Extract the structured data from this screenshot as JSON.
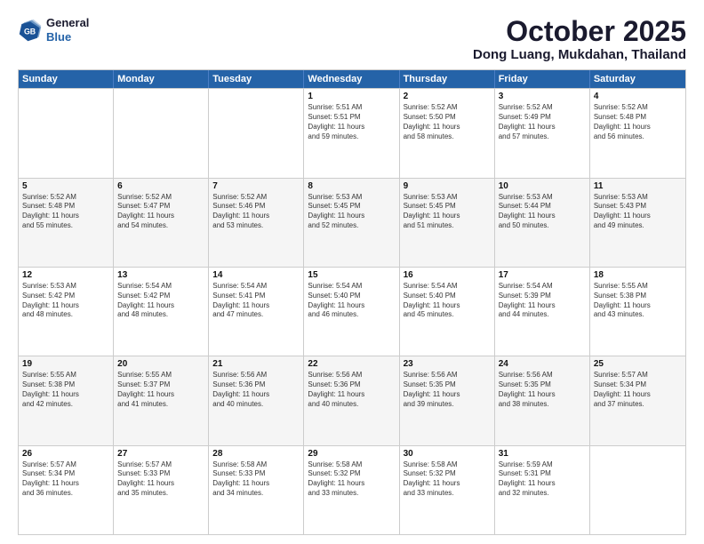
{
  "header": {
    "logo": {
      "general": "General",
      "blue": "Blue"
    },
    "title": "October 2025",
    "location": "Dong Luang, Mukdahan, Thailand"
  },
  "calendar": {
    "weekdays": [
      "Sunday",
      "Monday",
      "Tuesday",
      "Wednesday",
      "Thursday",
      "Friday",
      "Saturday"
    ],
    "rows": [
      [
        {
          "day": "",
          "empty": true
        },
        {
          "day": "",
          "empty": true
        },
        {
          "day": "",
          "empty": true
        },
        {
          "day": "1",
          "lines": [
            "Sunrise: 5:51 AM",
            "Sunset: 5:51 PM",
            "Daylight: 11 hours",
            "and 59 minutes."
          ]
        },
        {
          "day": "2",
          "lines": [
            "Sunrise: 5:52 AM",
            "Sunset: 5:50 PM",
            "Daylight: 11 hours",
            "and 58 minutes."
          ]
        },
        {
          "day": "3",
          "lines": [
            "Sunrise: 5:52 AM",
            "Sunset: 5:49 PM",
            "Daylight: 11 hours",
            "and 57 minutes."
          ]
        },
        {
          "day": "4",
          "lines": [
            "Sunrise: 5:52 AM",
            "Sunset: 5:48 PM",
            "Daylight: 11 hours",
            "and 56 minutes."
          ]
        }
      ],
      [
        {
          "day": "5",
          "lines": [
            "Sunrise: 5:52 AM",
            "Sunset: 5:48 PM",
            "Daylight: 11 hours",
            "and 55 minutes."
          ]
        },
        {
          "day": "6",
          "lines": [
            "Sunrise: 5:52 AM",
            "Sunset: 5:47 PM",
            "Daylight: 11 hours",
            "and 54 minutes."
          ]
        },
        {
          "day": "7",
          "lines": [
            "Sunrise: 5:52 AM",
            "Sunset: 5:46 PM",
            "Daylight: 11 hours",
            "and 53 minutes."
          ]
        },
        {
          "day": "8",
          "lines": [
            "Sunrise: 5:53 AM",
            "Sunset: 5:45 PM",
            "Daylight: 11 hours",
            "and 52 minutes."
          ]
        },
        {
          "day": "9",
          "lines": [
            "Sunrise: 5:53 AM",
            "Sunset: 5:45 PM",
            "Daylight: 11 hours",
            "and 51 minutes."
          ]
        },
        {
          "day": "10",
          "lines": [
            "Sunrise: 5:53 AM",
            "Sunset: 5:44 PM",
            "Daylight: 11 hours",
            "and 50 minutes."
          ]
        },
        {
          "day": "11",
          "lines": [
            "Sunrise: 5:53 AM",
            "Sunset: 5:43 PM",
            "Daylight: 11 hours",
            "and 49 minutes."
          ]
        }
      ],
      [
        {
          "day": "12",
          "lines": [
            "Sunrise: 5:53 AM",
            "Sunset: 5:42 PM",
            "Daylight: 11 hours",
            "and 48 minutes."
          ]
        },
        {
          "day": "13",
          "lines": [
            "Sunrise: 5:54 AM",
            "Sunset: 5:42 PM",
            "Daylight: 11 hours",
            "and 48 minutes."
          ]
        },
        {
          "day": "14",
          "lines": [
            "Sunrise: 5:54 AM",
            "Sunset: 5:41 PM",
            "Daylight: 11 hours",
            "and 47 minutes."
          ]
        },
        {
          "day": "15",
          "lines": [
            "Sunrise: 5:54 AM",
            "Sunset: 5:40 PM",
            "Daylight: 11 hours",
            "and 46 minutes."
          ]
        },
        {
          "day": "16",
          "lines": [
            "Sunrise: 5:54 AM",
            "Sunset: 5:40 PM",
            "Daylight: 11 hours",
            "and 45 minutes."
          ]
        },
        {
          "day": "17",
          "lines": [
            "Sunrise: 5:54 AM",
            "Sunset: 5:39 PM",
            "Daylight: 11 hours",
            "and 44 minutes."
          ]
        },
        {
          "day": "18",
          "lines": [
            "Sunrise: 5:55 AM",
            "Sunset: 5:38 PM",
            "Daylight: 11 hours",
            "and 43 minutes."
          ]
        }
      ],
      [
        {
          "day": "19",
          "lines": [
            "Sunrise: 5:55 AM",
            "Sunset: 5:38 PM",
            "Daylight: 11 hours",
            "and 42 minutes."
          ]
        },
        {
          "day": "20",
          "lines": [
            "Sunrise: 5:55 AM",
            "Sunset: 5:37 PM",
            "Daylight: 11 hours",
            "and 41 minutes."
          ]
        },
        {
          "day": "21",
          "lines": [
            "Sunrise: 5:56 AM",
            "Sunset: 5:36 PM",
            "Daylight: 11 hours",
            "and 40 minutes."
          ]
        },
        {
          "day": "22",
          "lines": [
            "Sunrise: 5:56 AM",
            "Sunset: 5:36 PM",
            "Daylight: 11 hours",
            "and 40 minutes."
          ]
        },
        {
          "day": "23",
          "lines": [
            "Sunrise: 5:56 AM",
            "Sunset: 5:35 PM",
            "Daylight: 11 hours",
            "and 39 minutes."
          ]
        },
        {
          "day": "24",
          "lines": [
            "Sunrise: 5:56 AM",
            "Sunset: 5:35 PM",
            "Daylight: 11 hours",
            "and 38 minutes."
          ]
        },
        {
          "day": "25",
          "lines": [
            "Sunrise: 5:57 AM",
            "Sunset: 5:34 PM",
            "Daylight: 11 hours",
            "and 37 minutes."
          ]
        }
      ],
      [
        {
          "day": "26",
          "lines": [
            "Sunrise: 5:57 AM",
            "Sunset: 5:34 PM",
            "Daylight: 11 hours",
            "and 36 minutes."
          ]
        },
        {
          "day": "27",
          "lines": [
            "Sunrise: 5:57 AM",
            "Sunset: 5:33 PM",
            "Daylight: 11 hours",
            "and 35 minutes."
          ]
        },
        {
          "day": "28",
          "lines": [
            "Sunrise: 5:58 AM",
            "Sunset: 5:33 PM",
            "Daylight: 11 hours",
            "and 34 minutes."
          ]
        },
        {
          "day": "29",
          "lines": [
            "Sunrise: 5:58 AM",
            "Sunset: 5:32 PM",
            "Daylight: 11 hours",
            "and 33 minutes."
          ]
        },
        {
          "day": "30",
          "lines": [
            "Sunrise: 5:58 AM",
            "Sunset: 5:32 PM",
            "Daylight: 11 hours",
            "and 33 minutes."
          ]
        },
        {
          "day": "31",
          "lines": [
            "Sunrise: 5:59 AM",
            "Sunset: 5:31 PM",
            "Daylight: 11 hours",
            "and 32 minutes."
          ]
        },
        {
          "day": "",
          "empty": true
        }
      ]
    ]
  }
}
